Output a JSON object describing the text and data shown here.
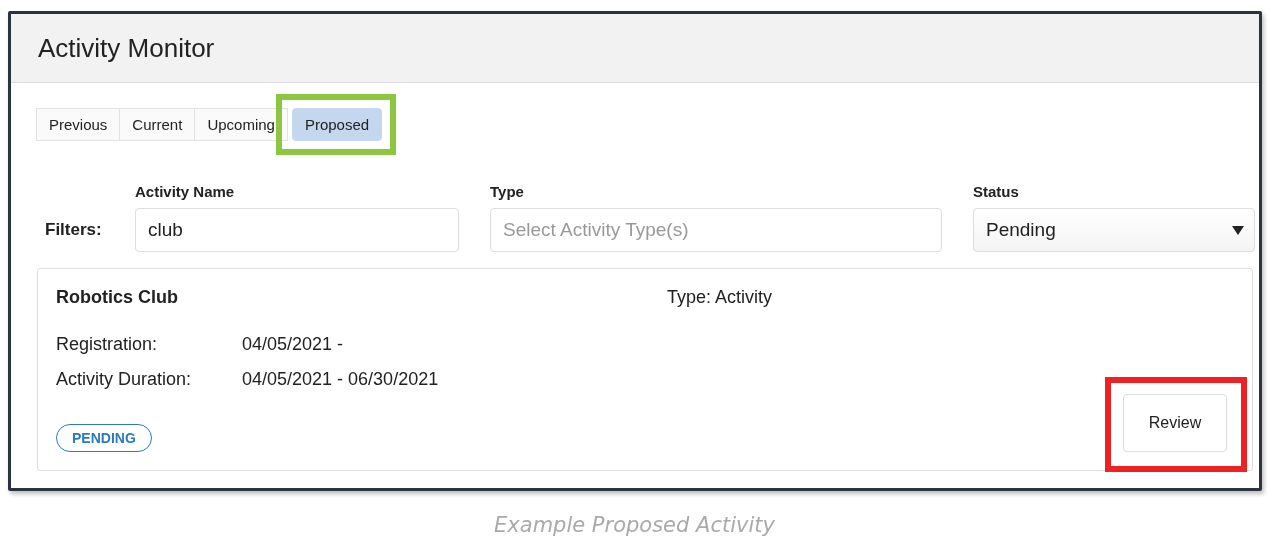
{
  "window": {
    "title": "Activity Monitor"
  },
  "tabs": [
    {
      "label": "Previous",
      "selected": false,
      "highlighted": false
    },
    {
      "label": "Current",
      "selected": false,
      "highlighted": false
    },
    {
      "label": "Upcoming",
      "selected": false,
      "highlighted": false
    },
    {
      "label": "Proposed",
      "selected": true,
      "highlighted": true
    }
  ],
  "filters": {
    "label": "Filters:",
    "fields": [
      {
        "kind": "text",
        "label": "Activity Name",
        "value": "club"
      },
      {
        "kind": "multiselect",
        "label": "Type",
        "placeholder": "Select Activity Type(s)"
      },
      {
        "kind": "select",
        "label": "Status",
        "value": "Pending"
      }
    ]
  },
  "activities": [
    {
      "name": "Robotics Club",
      "type": "Type: Activity",
      "details": [
        {
          "label": "Registration:",
          "value": "04/05/2021 -"
        },
        {
          "label": "Activity Duration:",
          "value": "04/05/2021 - 06/30/2021"
        }
      ],
      "status": "PENDING",
      "button": "Review",
      "button_highlighted": true
    }
  ],
  "caption": "Example Proposed Activity"
}
